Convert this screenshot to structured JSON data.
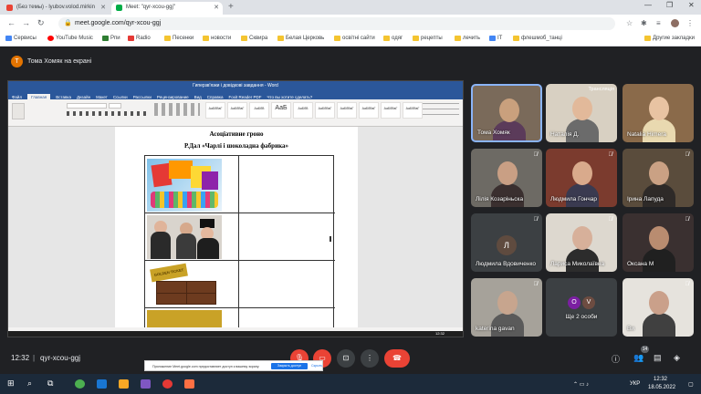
{
  "browser": {
    "tabs": [
      {
        "label": "(Без темы) - lyubov.volod.mirkin",
        "active": false
      },
      {
        "label": "Meet: \"qyr-xcou-ggj\"",
        "active": true
      }
    ],
    "new_tab": "+",
    "window_controls": [
      "—",
      "❐",
      "✕"
    ],
    "url": "meet.google.com/qyr-xcou-ggj",
    "bookmarks": [
      "Сервисы",
      "YouTube Music",
      "Рпи",
      "Radio",
      "Песенки",
      "новости",
      "Сквира",
      "Белая Церковь",
      "освітні сайти",
      "одяг",
      "рецепты",
      "лечить",
      "IT",
      "флешмоб_танці",
      "Другие закладки"
    ]
  },
  "meet": {
    "presenter": {
      "initial": "Т",
      "text": "Тома Хомяк на екрані"
    },
    "share_bar": {
      "text": "Приложение Meet.google.com предоставляет доступ к вашему экрану.",
      "stop": "Закрыть доступ",
      "hide": "Скрыть"
    },
    "participants": [
      {
        "name": "Тома Хомяк",
        "muted": false,
        "type": "video",
        "colors": [
          "#7a6a5a",
          "#c9a07d",
          "#5b3b5a"
        ]
      },
      {
        "name": "Наталія Д.",
        "muted": false,
        "type": "video",
        "colors": [
          "#d8d0c2",
          "#e2b99a",
          "#6b6b6b"
        ],
        "tag": "Трансляція"
      },
      {
        "name": "Natalia Himera",
        "muted": false,
        "type": "video",
        "colors": [
          "#8a6a4a",
          "#e8c3a2",
          "#e9d9b0"
        ]
      },
      {
        "name": "Лілія Козаріньска",
        "muted": true,
        "type": "video",
        "colors": [
          "#6d6a64",
          "#c99f84",
          "#3a2f2f"
        ]
      },
      {
        "name": "Людмила Гончар",
        "muted": true,
        "type": "video",
        "colors": [
          "#7b3b2e",
          "#d9aa8c",
          "#3a3a50"
        ]
      },
      {
        "name": "Ірина Лапуда",
        "muted": true,
        "type": "video",
        "colors": [
          "#5a4c3c",
          "#caa184",
          "#2e2a28"
        ]
      },
      {
        "name": "Людмила Вдовиченко",
        "muted": true,
        "type": "avatar",
        "initial": "Л",
        "avatar_color": "#5f4b3f"
      },
      {
        "name": "Лариса Миколаївна",
        "muted": true,
        "type": "video",
        "colors": [
          "#ddd8cf",
          "#d7b09a",
          "#2c2c2c"
        ]
      },
      {
        "name": "Оксана М",
        "muted": true,
        "type": "video",
        "colors": [
          "#3a3030",
          "#b98c70",
          "#202020"
        ]
      },
      {
        "name": "katerina gavan",
        "muted": true,
        "type": "video",
        "colors": [
          "#a6a29a",
          "#c7a58e",
          "#5a5a5a"
        ]
      },
      {
        "name": "Ще 2 особи",
        "muted": false,
        "type": "more",
        "initials": [
          "О",
          "V"
        ]
      },
      {
        "name": "Ви",
        "muted": true,
        "type": "video",
        "colors": [
          "#e6e3dd",
          "#caa08a",
          "#404040"
        ]
      }
    ],
    "bottom": {
      "time": "12:32",
      "code": "qyr-xcou-ggj",
      "participants_count": "14"
    }
  },
  "word": {
    "window_title": "Гиперзв'язки і довідкові завдання - Word",
    "menu": [
      "Файл",
      "Главная",
      "Вставка",
      "Дизайн",
      "Макет",
      "Ссылки",
      "Рассылки",
      "Рецензирование",
      "Вид",
      "Справка",
      "Foxit Reader PDF",
      "Что вы хотите сделать?"
    ],
    "styles": [
      "АаБбВвГ",
      "АаБбВвГ",
      "АаБбВ",
      "АаБ",
      "АаБбВ",
      "АаБбВвГ",
      "АаБбВвГ",
      "АаБбВвГ",
      "АаБбВвГ",
      "АаБбВвГ"
    ],
    "heading1": "Асоціативне гроно",
    "heading2": "Р.Дал «Чарлі і шоколадна фабрика»",
    "golden_ticket": "GOLDEN TICKET",
    "status_time": "12:32"
  },
  "taskbar": {
    "lang": "УКР",
    "time": "12:32",
    "date": "18.05.2022"
  }
}
